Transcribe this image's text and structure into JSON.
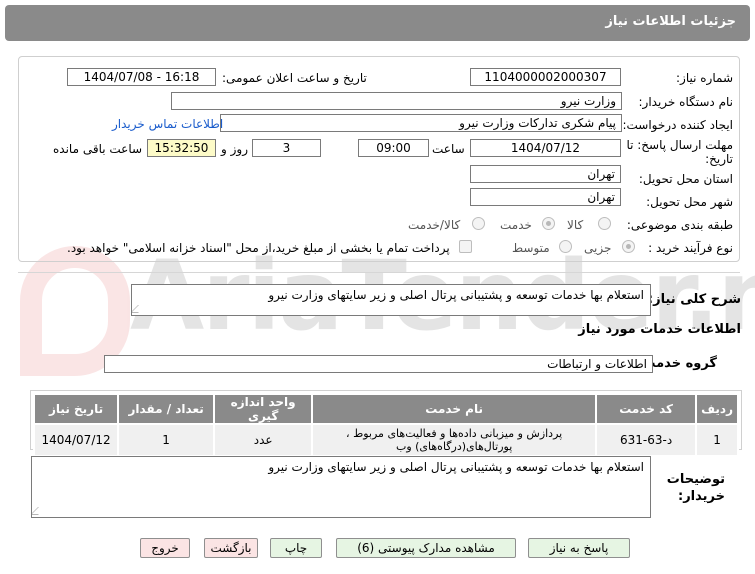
{
  "header": {
    "title": "جزئیات اطلاعات نیاز"
  },
  "form": {
    "need_number_label": "شماره نیاز:",
    "need_number": "1104000002000307",
    "announce_label": "تاریخ و ساعت اعلان عمومی:",
    "announce_value": "1404/07/08 - 16:18",
    "buyer_org_label": "نام دستگاه خریدار:",
    "buyer_org": "وزارت نیرو",
    "creator_label": "ایجاد کننده درخواست:",
    "creator": "پیام شکری تدارکات وزارت نیرو",
    "contact_link": "اطلاعات تماس خریدار",
    "deadline_label_1": "مهلت ارسال پاسخ: تا",
    "deadline_label_2": "تاریخ:",
    "deadline_date": "1404/07/12",
    "time_label": "ساعت",
    "deadline_time": "09:00",
    "days_value": "3",
    "days_label": "روز و",
    "remaining_time": "15:32:50",
    "remaining_label": "ساعت باقی مانده",
    "province_label": "استان محل تحویل:",
    "province": "تهران",
    "city_label": "شهر محل تحویل:",
    "city": "تهران",
    "category_label": "طبقه بندی موضوعی:",
    "category_options": [
      "کالا",
      "خدمت",
      "کالا/خدمت"
    ],
    "category_selected": "خدمت",
    "purchase_type_label": "نوع فرآیند خرید :",
    "purchase_options": [
      "جزیی",
      "متوسط"
    ],
    "purchase_selected": "جزیی",
    "treasury_note": "پرداخت تمام یا بخشی از مبلغ خرید،از محل \"اسناد خزانه اسلامی\" خواهد بود."
  },
  "summary": {
    "label": "شرح کلی نیاز:",
    "text": "استعلام بها خدمات توسعه و پشتیبانی پرتال اصلی و زیر سایتهای وزارت نیرو"
  },
  "services": {
    "section_title": "اطلاعات خدمات مورد نیاز",
    "group_label": "گروه خدمت:",
    "group_value": "اطلاعات و ارتباطات",
    "table": {
      "headers": [
        "ردیف",
        "کد خدمت",
        "نام خدمت",
        "واحد اندازه گیری",
        "تعداد / مقدار",
        "تاریخ نیاز"
      ],
      "rows": [
        [
          "1",
          "د-63-631",
          "پردازش و میزبانی داده‌ها و فعالیت‌های مربوط ، پورتال‌های(درگاه‌های) وب",
          "عدد",
          "1",
          "1404/07/12"
        ]
      ]
    }
  },
  "buyer_notes": {
    "label_1": "توضیحات",
    "label_2": "خریدار:",
    "text": "استعلام بها خدمات توسعه و پشتیبانی پرتال اصلی و زیر سایتهای وزارت نیرو"
  },
  "buttons": {
    "reply": "پاسخ به نیاز",
    "attachments": "مشاهده مدارک پیوستی (6)",
    "print": "چاپ",
    "back": "بازگشت",
    "exit": "خروج"
  },
  "watermark": {
    "text": "AriaTender.neT"
  },
  "colors": {
    "header_bg": "#8a8a8a",
    "link": "#1a5ccc",
    "highlight": "#fdfbc8"
  }
}
